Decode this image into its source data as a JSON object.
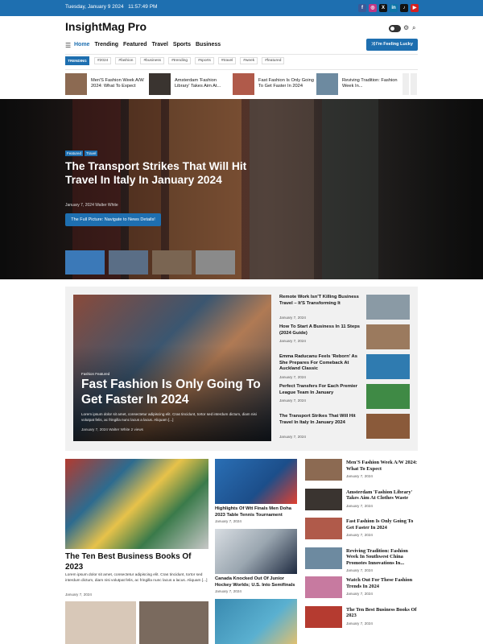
{
  "topbar": {
    "date": "Tuesday, January 9 2024",
    "time": "11:57:49 PM",
    "social": [
      {
        "name": "facebook-icon",
        "color": "#3b5998",
        "g": "f"
      },
      {
        "name": "instagram-icon",
        "color": "#c13584",
        "g": "◎"
      },
      {
        "name": "x-icon",
        "color": "#111111",
        "g": "X"
      },
      {
        "name": "linkedin-icon",
        "color": "#0e76a8",
        "g": "in"
      },
      {
        "name": "tiktok-icon",
        "color": "#111111",
        "g": "♪"
      },
      {
        "name": "youtube-icon",
        "color": "#d62020",
        "g": "▶"
      }
    ]
  },
  "header": {
    "logo": "InsightMag Pro",
    "lucky_button": "⤨ I'm Feeling Lucky"
  },
  "nav": [
    "Home",
    "Trending",
    "Featured",
    "Travel",
    "Sports",
    "Business"
  ],
  "trending": {
    "label": "TRENDING",
    "tags": [
      "#2024",
      "#fashion",
      "#business",
      "#trending",
      "#sports",
      "#travel",
      "#week",
      "#featured"
    ]
  },
  "ticker": [
    {
      "title": "Men'S Fashion Week A/W 2024: What To Expect",
      "color": "#8c6a52"
    },
    {
      "title": "Amsterdam 'Fashion Library' Takes Aim At...",
      "color": "#3a3430"
    },
    {
      "title": "Fast Fashion Is Only Going To Get Faster In 2024",
      "color": "#b05a4a"
    },
    {
      "title": "Reviving Tradition: Fashion Week In...",
      "color": "#6d8aa0"
    }
  ],
  "hero": {
    "categories": [
      "Featured",
      "Travel"
    ],
    "title": "The Transport Strikes That Will Hit Travel In Italy In January 2024",
    "meta": "January 7, 2024  Walter White",
    "button": "The Full Picture: Navigate to News Details!",
    "thumbs": [
      "#3b79b8",
      "#5a6e86",
      "#7a6552",
      "#8a8a8a"
    ]
  },
  "featured": {
    "category": "Fashion  Featured",
    "title": "Fast Fashion Is Only Going To Get Faster In 2024",
    "excerpt": "Lorem ipsum dolor sit amet, consectetur adipiscing elit. Cras tincidunt, tortor sed interdum dictum, diam nisi volutpat felis, ac fringilla nunc lacus a lacus. Aliquam [...]",
    "meta": "January 7, 2024  Walter White  2 views"
  },
  "side_posts": [
    {
      "title": "Remote Work Isn'T Killing Business Travel – It'S Transforming It",
      "date": "January 7, 2024",
      "color": "#8a9aa5"
    },
    {
      "title": "How To Start A Business In 11 Steps (2024 Guide)",
      "date": "January 7, 2024",
      "color": "#9b7a5e"
    },
    {
      "title": "Emma Raducanu Feels 'Reborn' As She Prepares For Comeback At Auckland Classic",
      "date": "January 7, 2024",
      "color": "#2f7bb0"
    },
    {
      "title": "Perfect Transfers For Each Premier League Team In January",
      "date": "January 7, 2024",
      "color": "#3f8a45"
    },
    {
      "title": "The Transport Strikes That Will Hit Travel In Italy In January 2024",
      "date": "January 7, 2024",
      "color": "#8a5a3a"
    }
  ],
  "big_post": {
    "title": "The Ten Best Business Books Of 2023",
    "excerpt": "Lorem ipsum dolor sit amet, consectetur adipiscing elit. Cras tincidunt, tortor sed interdum dictum, diam nisi volutpat felis, ac fringilla nunc lacus a lacus. Aliquam [...]",
    "date": "January 7, 2024"
  },
  "mid_posts": [
    {
      "title": "Highlights Of Wtt Finals Men Doha 2023 Table Tennis Tournament",
      "date": "January 7, 2024"
    },
    {
      "title": "Canada Knocked Out Of Junior Hockey Worlds; U.S. Into Semifinals",
      "date": "January 7, 2024"
    }
  ],
  "right_posts": [
    {
      "title": "Men'S Fashion Week A/W 2024: What To Expect",
      "date": "January 7, 2024",
      "color": "#8c6a52"
    },
    {
      "title": "Amsterdam 'Fashion Library' Takes Aim At Clothes Waste",
      "date": "January 7, 2024",
      "color": "#3a3430"
    },
    {
      "title": "Fast Fashion Is Only Going To Get Faster In 2024",
      "date": "January 7, 2024",
      "color": "#b05a4a"
    },
    {
      "title": "Reviving Tradition: Fashion Week In Southwest China Promotes Innovations In...",
      "date": "January 7, 2024",
      "color": "#6d8aa0"
    },
    {
      "title": "Watch Out For These Fashion Trends In 2024",
      "date": "January 7, 2024",
      "color": "#c77aa0"
    },
    {
      "title": "The Ten Best Business Books Of 2023",
      "date": "January 7, 2024",
      "color": "#b53b30"
    }
  ]
}
